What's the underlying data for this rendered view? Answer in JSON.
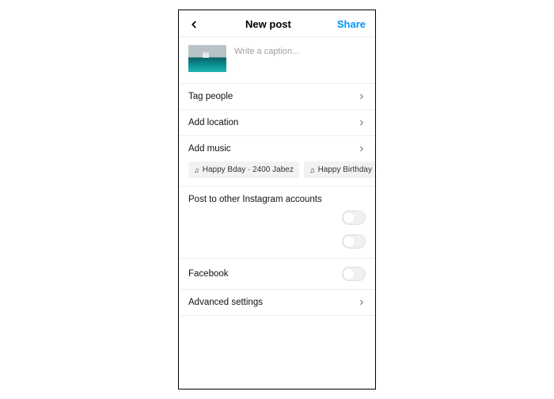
{
  "header": {
    "title": "New post",
    "share_label": "Share"
  },
  "caption": {
    "placeholder": "Write a caption..."
  },
  "rows": {
    "tag_people": "Tag people",
    "add_location": "Add location",
    "add_music": "Add music",
    "post_other_accounts": "Post to other Instagram accounts",
    "facebook": "Facebook",
    "advanced_settings": "Advanced settings"
  },
  "music_suggestions": [
    {
      "label": "Happy Bday · 2400 Jabez"
    },
    {
      "label": "Happy Birthday · Jo"
    }
  ],
  "toggles": {
    "account1": false,
    "account2": false,
    "facebook": false
  },
  "icons": {
    "back": "chevron-left",
    "chevron": "chevron-right",
    "music_note": "♫"
  }
}
